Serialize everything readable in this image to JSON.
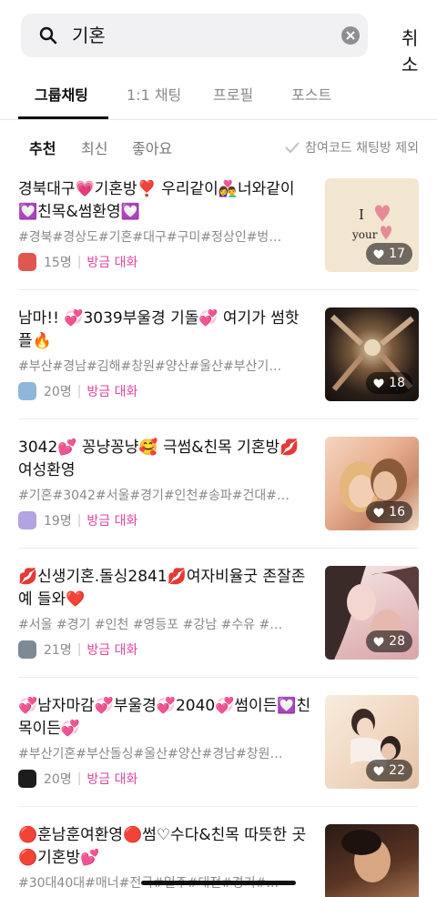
{
  "search": {
    "query": "기혼",
    "cancel_label": "취소"
  },
  "tabs": [
    "그룹채팅",
    "1:1 채팅",
    "프로필",
    "포스트"
  ],
  "sort": [
    "추천",
    "최신",
    "좋아요"
  ],
  "exclude_label": "참여코드 채팅방 제외",
  "recent_label": "방금 대화",
  "items": [
    {
      "title": "경북대구💗기혼방❣️ 우리같이👩‍❤️‍👨너와같이💟친목&썸환영💟",
      "tags": "#경북#경상도#기혼#대구#구미#정상인#벙…",
      "members": "15명",
      "likes": "17",
      "avatar_color": "#e0574f"
    },
    {
      "title": "남마!! 💞3039부울경 기돌💞 여기가 썸핫플🔥",
      "tags": "#부산#경남#김해#창원#양산#울산#부산기…",
      "members": "20명",
      "likes": "18",
      "avatar_color": "#8fb7dc"
    },
    {
      "title": "3042💕 꽁냥꽁냥🥰 극썸&친목 기혼방💋여성환영",
      "tags": "#기혼#3042#서울#경기#인천#송파#건대#…",
      "members": "19명",
      "likes": "16",
      "avatar_color": "#b3a3e0"
    },
    {
      "title": "💋신생기혼.돌싱2841💋여자비율굿 존잘존예 들와❤️",
      "tags": "#서울 #경기 #인천 #영등포 #강남 #수유 #…",
      "members": "21명",
      "likes": "28",
      "avatar_color": "#7d8a96"
    },
    {
      "title": "💞남자마감💞부울경💞2040💞썸이든💟친목이든💞",
      "tags": "#부산기혼#부산돌싱#울산#양산#경남#창원…",
      "members": "20명",
      "likes": "22",
      "avatar_color": "#1c1c1c"
    },
    {
      "title": "🔴훈남훈여환영🔴썸♡수다&친목 따뜻한 곳🔴기혼방💕",
      "tags": "#30대40대#매너#전국#일주#대전#경기#…",
      "members": "",
      "likes": "",
      "avatar_color": "#333333"
    }
  ],
  "icons": {
    "search": "search-icon",
    "clear": "clear-icon",
    "check": "check-icon",
    "heart": "heart-icon"
  },
  "colors": {
    "accent": "#e0459b",
    "thumb1": "#f3e6d0",
    "heart": "#e78a98"
  }
}
